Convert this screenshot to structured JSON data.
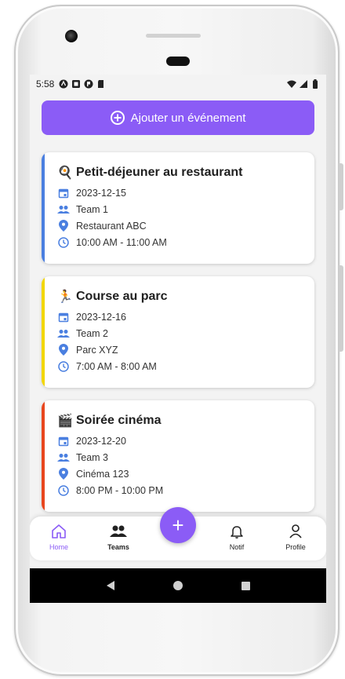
{
  "status": {
    "time": "5:58"
  },
  "actions": {
    "add_event_label": "Ajouter un événement"
  },
  "events": [
    {
      "emoji": "🍳",
      "title": "Petit-déjeuner au restaurant",
      "date": "2023-12-15",
      "team": "Team 1",
      "location": "Restaurant ABC",
      "time": "10:00 AM - 11:00 AM",
      "accent_color": "#4a7fe0"
    },
    {
      "emoji": "🏃",
      "title": "Course au parc",
      "date": "2023-12-16",
      "team": "Team 2",
      "location": "Parc XYZ",
      "time": "7:00 AM - 8:00 AM",
      "accent_color": "#f2d600"
    },
    {
      "emoji": "🎬",
      "title": "Soirée cinéma",
      "date": "2023-12-20",
      "team": "Team 3",
      "location": "Cinéma 123",
      "time": "8:00 PM - 10:00 PM",
      "accent_color": "#e8461e"
    }
  ],
  "nav": {
    "home": "Home",
    "teams": "Teams",
    "notif": "Notif",
    "profile": "Profile",
    "fab_symbol": "+"
  },
  "colors": {
    "primary": "#8b5cf6",
    "icon_blue": "#4a7fe0"
  }
}
